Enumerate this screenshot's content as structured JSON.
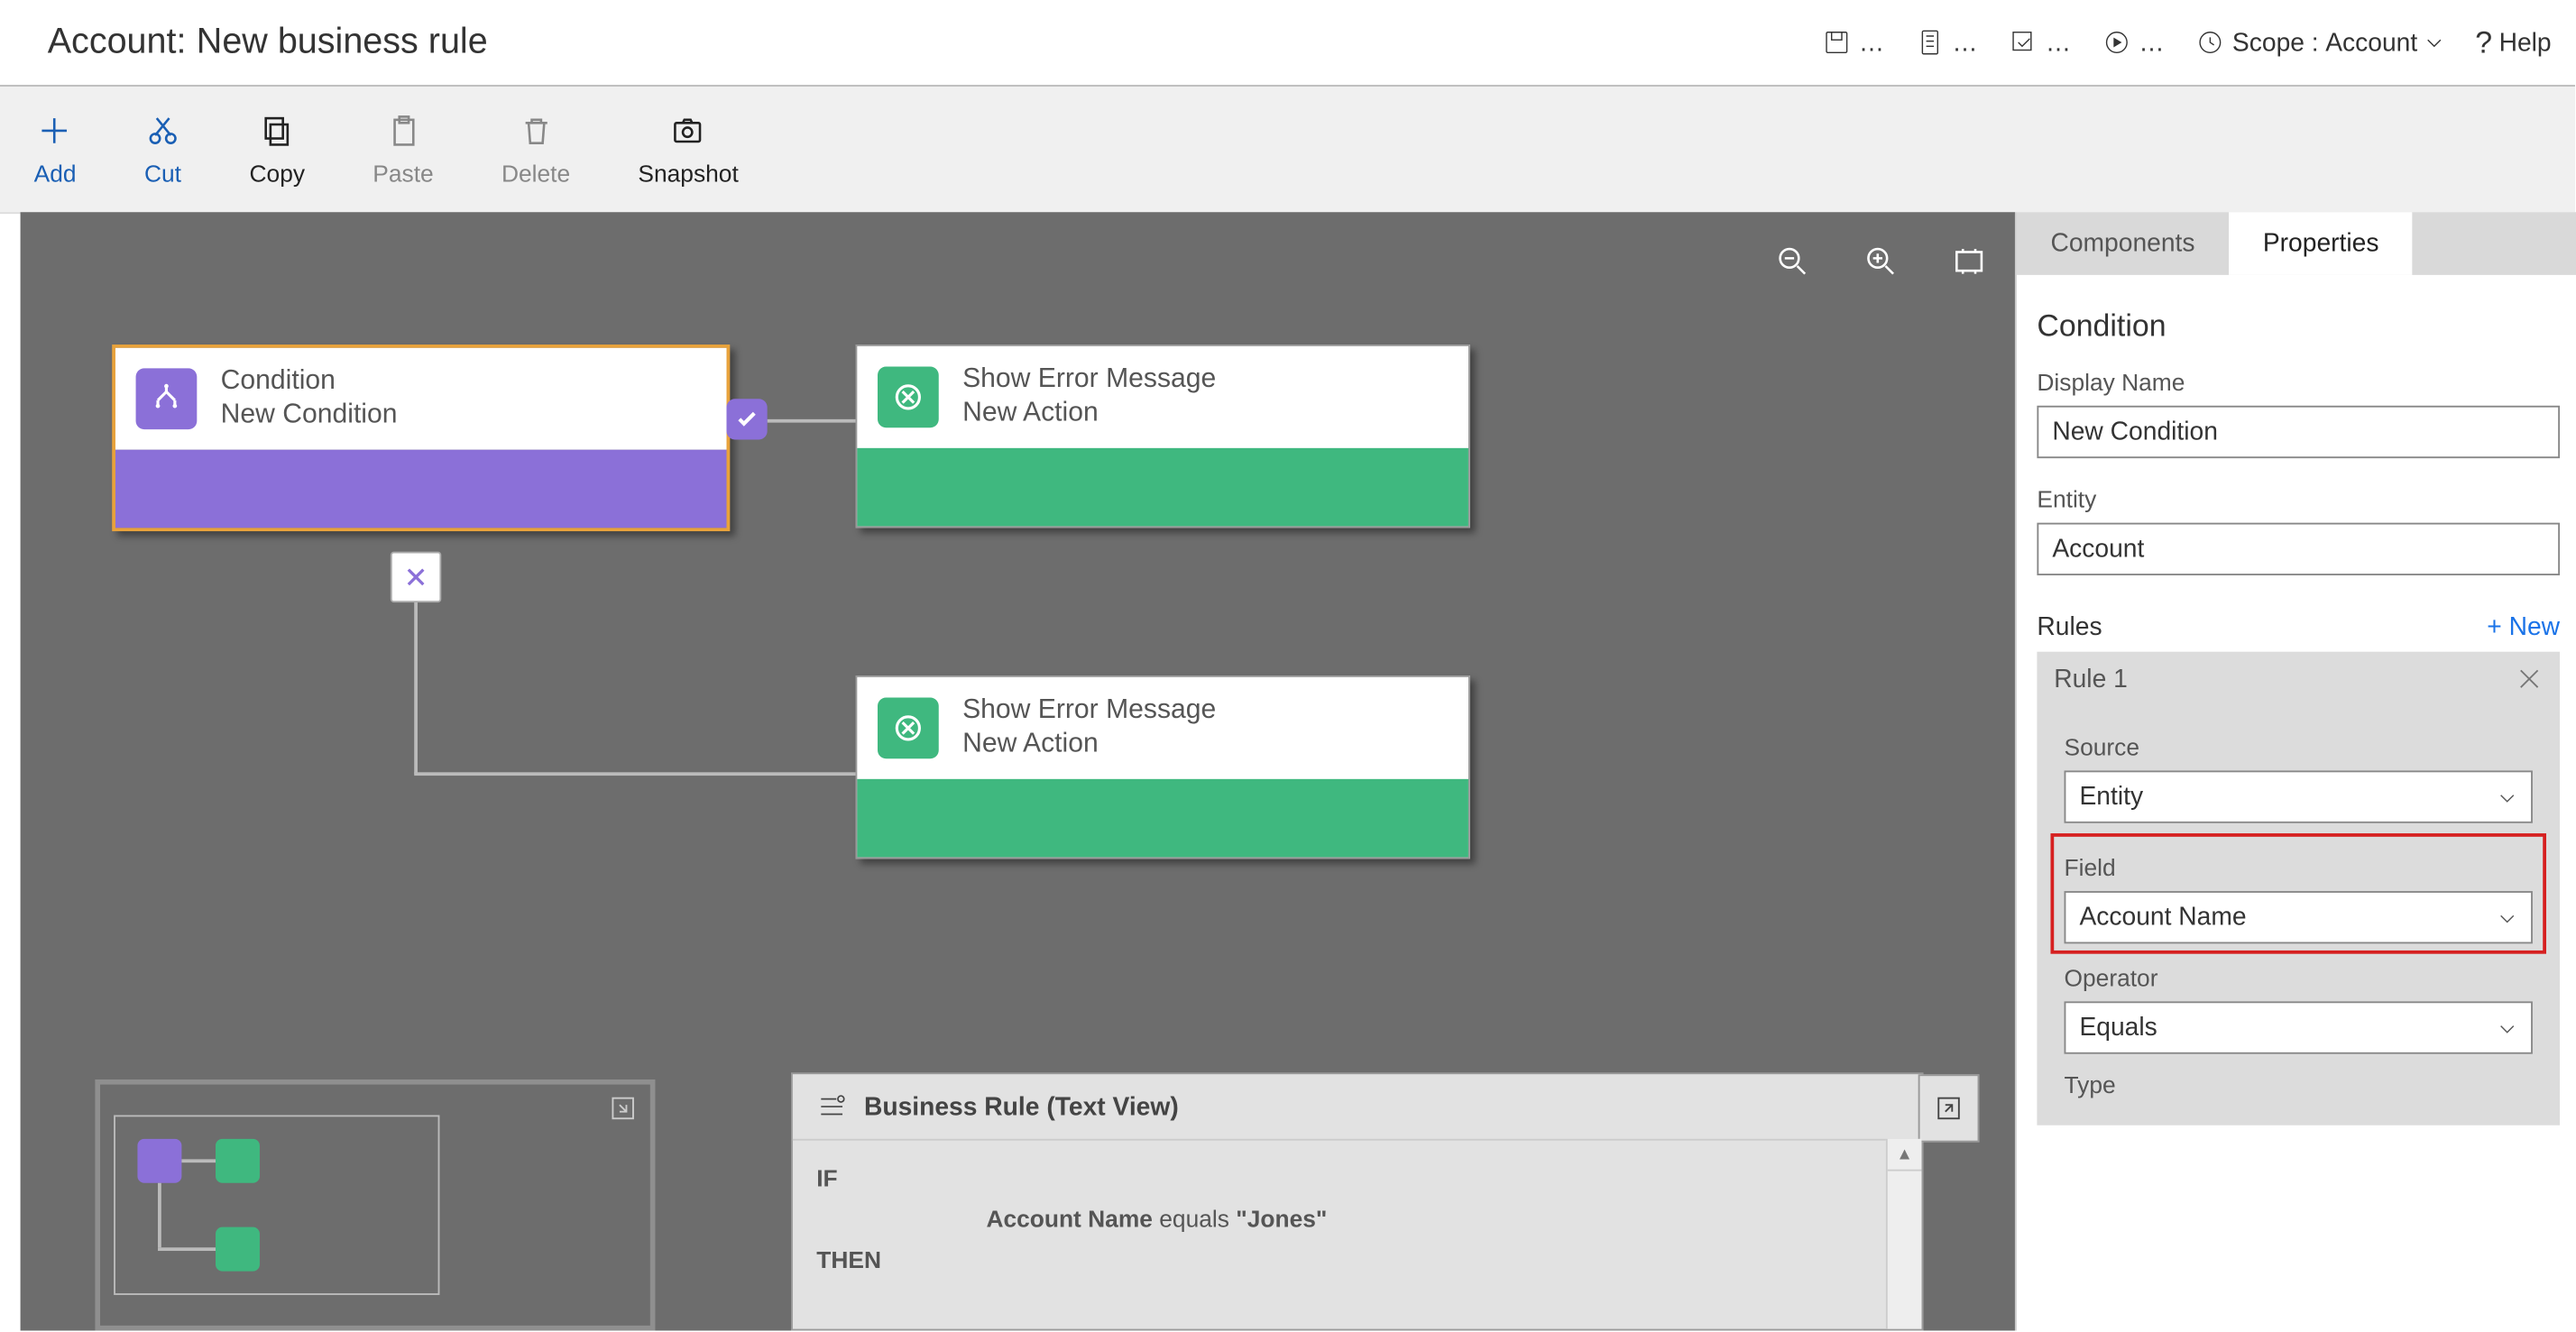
{
  "header": {
    "entity": "Account:",
    "rule_name": "New business rule",
    "scope_label": "Scope :",
    "scope_value": "Account",
    "help": "Help"
  },
  "toolbar": {
    "add": "Add",
    "cut": "Cut",
    "copy": "Copy",
    "paste": "Paste",
    "delete": "Delete",
    "snapshot": "Snapshot"
  },
  "canvas": {
    "condition": {
      "title": "Condition",
      "sub": "New Condition"
    },
    "action1": {
      "title": "Show Error Message",
      "sub": "New Action"
    },
    "action2": {
      "title": "Show Error Message",
      "sub": "New Action"
    }
  },
  "textview": {
    "title": "Business Rule (Text View)",
    "if": "IF",
    "line1_a": "Account Name",
    "line1_b": " equals ",
    "line1_c": "\"Jones\"",
    "then": "THEN"
  },
  "panel": {
    "tab_components": "Components",
    "tab_properties": "Properties",
    "section": "Condition",
    "display_name_label": "Display Name",
    "display_name_value": "New Condition",
    "entity_label": "Entity",
    "entity_value": "Account",
    "rules_label": "Rules",
    "new_link": "+  New",
    "rule1": "Rule 1",
    "source_label": "Source",
    "source_value": "Entity",
    "field_label": "Field",
    "field_value": "Account Name",
    "operator_label": "Operator",
    "operator_value": "Equals",
    "type_label": "Type"
  }
}
